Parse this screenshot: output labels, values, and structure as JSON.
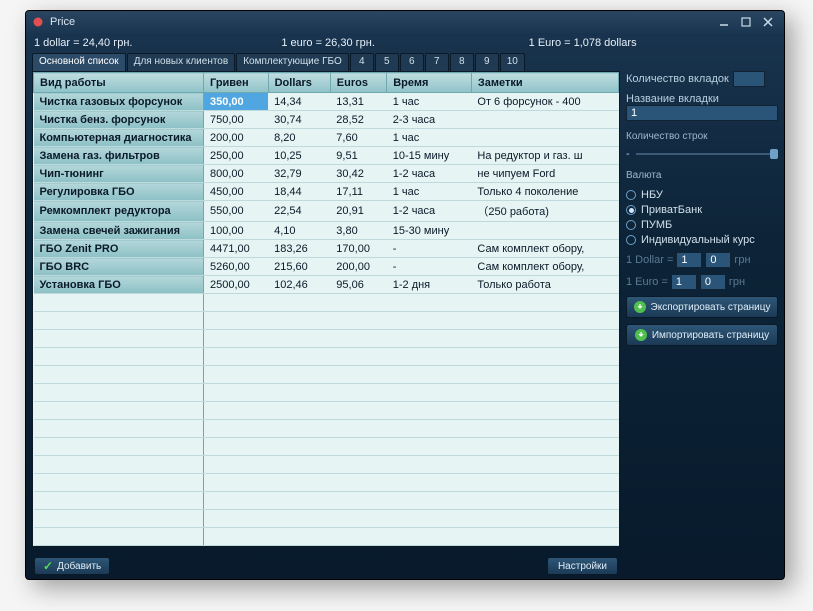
{
  "window": {
    "title": "Price"
  },
  "rates": {
    "dollar": "1 dollar = 24,40 грн.",
    "euro": "1 euro = 26,30 грн.",
    "cross": "1 Euro = 1,078 dollars"
  },
  "tabs": {
    "items": [
      {
        "label": "Основной список",
        "active": true
      },
      {
        "label": "Для новых клиентов",
        "active": false
      },
      {
        "label": "Комплектующие ГБО",
        "active": false
      },
      {
        "label": "4",
        "active": false,
        "num": true
      },
      {
        "label": "5",
        "active": false,
        "num": true
      },
      {
        "label": "6",
        "active": false,
        "num": true
      },
      {
        "label": "7",
        "active": false,
        "num": true
      },
      {
        "label": "8",
        "active": false,
        "num": true
      },
      {
        "label": "9",
        "active": false,
        "num": true
      },
      {
        "label": "10",
        "active": false,
        "num": true
      }
    ]
  },
  "table": {
    "headers": [
      "Вид работы",
      "Гривен",
      "Dollars",
      "Euros",
      "Время",
      "Заметки"
    ],
    "rows": [
      {
        "name": "Чистка газовых форсунок",
        "uah": "350,00",
        "usd": "14,34",
        "eur": "13,31",
        "time": "1 час",
        "note": "От 6 форсунок - 400",
        "sel": true
      },
      {
        "name": "Чистка бенз. форсунок",
        "uah": "750,00",
        "usd": "30,74",
        "eur": "28,52",
        "time": "2-3 часа",
        "note": ""
      },
      {
        "name": "Компьютерная диагностика",
        "uah": "200,00",
        "usd": "8,20",
        "eur": "7,60",
        "time": "1 час",
        "note": ""
      },
      {
        "name": "Замена газ. фильтров",
        "uah": "250,00",
        "usd": "10,25",
        "eur": "9,51",
        "time": "10-15 мину",
        "note": "На редуктор и газ. ш"
      },
      {
        "name": "Чип-тюнинг",
        "uah": "800,00",
        "usd": "32,79",
        "eur": "30,42",
        "time": "1-2 часа",
        "note": "не чипуем Ford"
      },
      {
        "name": "Регулировка ГБО",
        "uah": "450,00",
        "usd": "18,44",
        "eur": "17,11",
        "time": "1 час",
        "note": "Только 4 поколение"
      },
      {
        "name": "Ремкомплект редуктора",
        "uah": "550,00",
        "usd": "22,54",
        "eur": "20,91",
        "time": "1-2 часа",
        "note": "（250 работа)"
      },
      {
        "name": "Замена свечей зажигания",
        "uah": "100,00",
        "usd": "4,10",
        "eur": "3,80",
        "time": "15-30 мину",
        "note": ""
      },
      {
        "name": "ГБО Zenit PRO",
        "uah": "4471,00",
        "usd": "183,26",
        "eur": "170,00",
        "time": "-",
        "note": "Сам комплект обору,"
      },
      {
        "name": "ГБО BRC",
        "uah": "5260,00",
        "usd": "215,60",
        "eur": "200,00",
        "time": "-",
        "note": "Сам комплект обору,"
      },
      {
        "name": "Установка ГБО",
        "uah": "2500,00",
        "usd": "102,46",
        "eur": "95,06",
        "time": "1-2 дня",
        "note": "Только работа"
      }
    ],
    "emptyRows": 15
  },
  "side": {
    "tabCountLabel": "Количество вкладок",
    "tabNameLabel": "Название вкладки",
    "tabNameValue": "1",
    "rowCountLabel": "Количество строк",
    "currencyLabel": "Валюта",
    "radios": [
      {
        "label": "НБУ",
        "checked": false
      },
      {
        "label": "ПриватБанк",
        "checked": true
      },
      {
        "label": "ПУМБ",
        "checked": false
      },
      {
        "label": "Индивидуальный курс",
        "checked": false
      }
    ],
    "dollarLabel": "1 Dollar =",
    "dollarInt": "1",
    "dollarFrac": "0",
    "euroLabel": "1 Euro =",
    "euroInt": "1",
    "euroFrac": "0",
    "grnSuffix": "грн",
    "exportLabel": "Экспортировать страницу",
    "importLabel": "Импортировать страницу"
  },
  "bottom": {
    "addLabel": "Добавить",
    "settingsLabel": "Настройки"
  }
}
